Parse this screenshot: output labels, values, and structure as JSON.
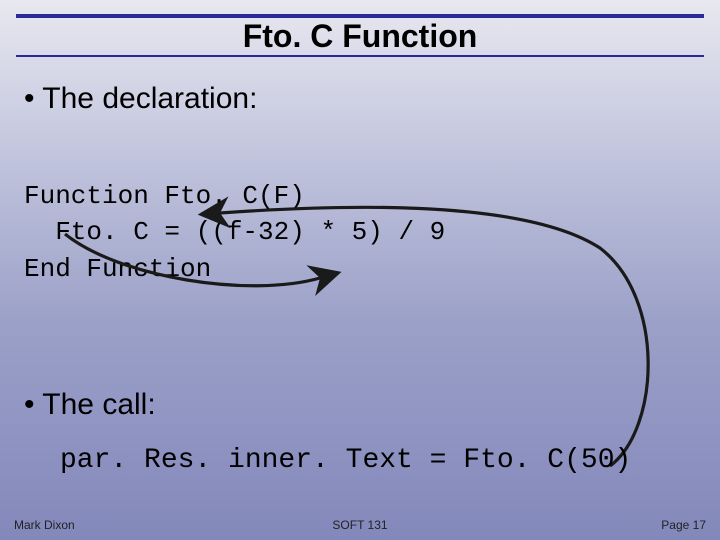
{
  "title": "Fto. C Function",
  "bullets": {
    "declaration": "• The declaration:",
    "call": "• The call:"
  },
  "code": {
    "decl_line1": "Function Fto. C(F)",
    "decl_line2": "  Fto. C = ((f-32) * 5) / 9",
    "decl_line3": "End Function",
    "call_line": "par. Res. inner. Text = Fto. C(50)"
  },
  "footer": {
    "author": "Mark Dixon",
    "course": "SOFT 131",
    "page": "Page 17"
  }
}
